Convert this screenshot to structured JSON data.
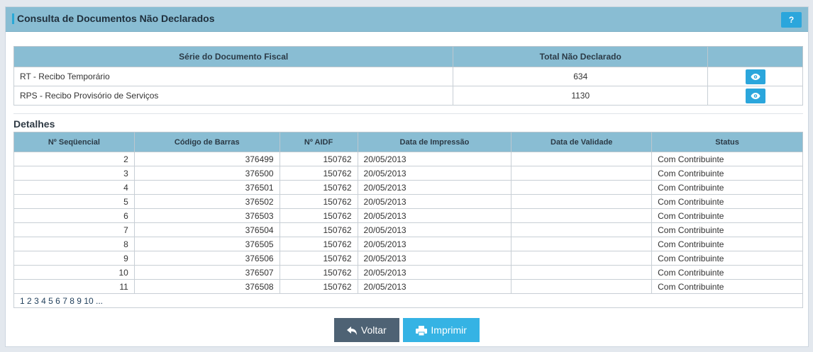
{
  "panel": {
    "title": "Consulta de Documentos Não Declarados",
    "help_label": "?"
  },
  "summary": {
    "headers": [
      "Série do Documento Fiscal",
      "Total Não Declarado",
      ""
    ],
    "rows": [
      {
        "serie": "RT - Recibo Temporário",
        "total": "634",
        "action_icon": "eye-icon"
      },
      {
        "serie": "RPS - Recibo Provisório de Serviços",
        "total": "1130",
        "action_icon": "eye-icon"
      }
    ]
  },
  "details": {
    "title": "Detalhes",
    "headers": [
      "Nº Seqüencial",
      "Código de Barras",
      "Nº AIDF",
      "Data de Impressão",
      "Data de Validade",
      "Status"
    ],
    "rows": [
      {
        "seq": "2",
        "barcode": "376499",
        "aidf": "150762",
        "print_date": "20/05/2013",
        "valid_date": "",
        "status": "Com Contribuinte"
      },
      {
        "seq": "3",
        "barcode": "376500",
        "aidf": "150762",
        "print_date": "20/05/2013",
        "valid_date": "",
        "status": "Com Contribuinte"
      },
      {
        "seq": "4",
        "barcode": "376501",
        "aidf": "150762",
        "print_date": "20/05/2013",
        "valid_date": "",
        "status": "Com Contribuinte"
      },
      {
        "seq": "5",
        "barcode": "376502",
        "aidf": "150762",
        "print_date": "20/05/2013",
        "valid_date": "",
        "status": "Com Contribuinte"
      },
      {
        "seq": "6",
        "barcode": "376503",
        "aidf": "150762",
        "print_date": "20/05/2013",
        "valid_date": "",
        "status": "Com Contribuinte"
      },
      {
        "seq": "7",
        "barcode": "376504",
        "aidf": "150762",
        "print_date": "20/05/2013",
        "valid_date": "",
        "status": "Com Contribuinte"
      },
      {
        "seq": "8",
        "barcode": "376505",
        "aidf": "150762",
        "print_date": "20/05/2013",
        "valid_date": "",
        "status": "Com Contribuinte"
      },
      {
        "seq": "9",
        "barcode": "376506",
        "aidf": "150762",
        "print_date": "20/05/2013",
        "valid_date": "",
        "status": "Com Contribuinte"
      },
      {
        "seq": "10",
        "barcode": "376507",
        "aidf": "150762",
        "print_date": "20/05/2013",
        "valid_date": "",
        "status": "Com Contribuinte"
      },
      {
        "seq": "11",
        "barcode": "376508",
        "aidf": "150762",
        "print_date": "20/05/2013",
        "valid_date": "",
        "status": "Com Contribuinte"
      }
    ],
    "pages": [
      "1",
      "2",
      "3",
      "4",
      "5",
      "6",
      "7",
      "8",
      "9",
      "10",
      "..."
    ]
  },
  "actions": {
    "back_label": "Voltar",
    "back_icon": "reply-arrow-icon",
    "print_label": "Imprimir",
    "print_icon": "printer-icon"
  },
  "colors": {
    "header_bg": "#89bdd3",
    "accent": "#2ba6dc",
    "back_button": "#4e6274",
    "print_button": "#35b3e4"
  }
}
